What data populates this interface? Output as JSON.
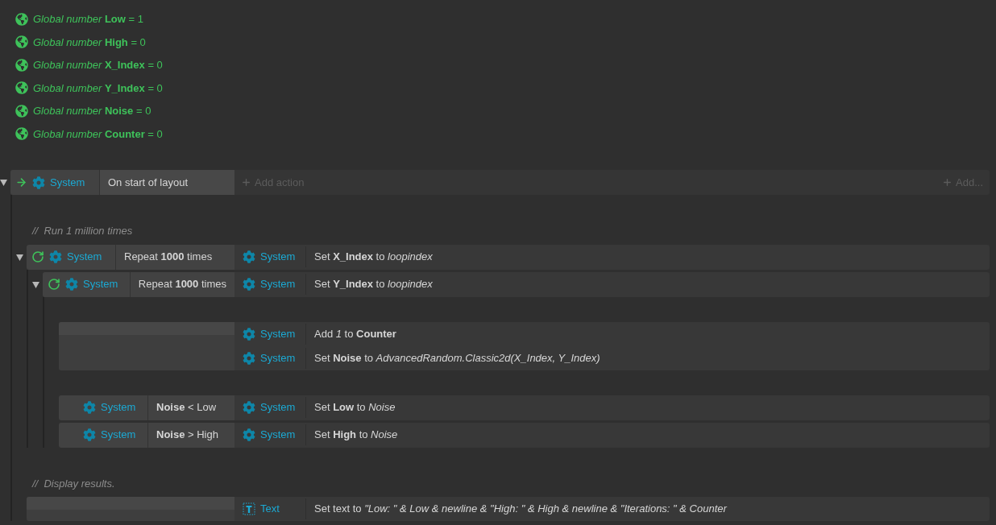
{
  "globals": [
    {
      "text": "*Global number* **Low** = 1"
    },
    {
      "text": "*Global number* **High** = 0"
    },
    {
      "text": "*Global number* **X_Index** = 0"
    },
    {
      "text": "*Global number* **Y_Index** = 0"
    },
    {
      "text": "*Global number* **Noise** = 0"
    },
    {
      "text": "*Global number* **Counter** = 0"
    }
  ],
  "events": [
    {
      "kind": "event",
      "expanded": true,
      "conditions": [
        {
          "kind": "trigger",
          "object": "System",
          "text": "On start of layout"
        }
      ],
      "add_action": "Add action",
      "add_more": "Add...",
      "children": [
        {
          "kind": "comment",
          "text": "//  Run 1 million times"
        },
        {
          "kind": "event",
          "expanded": true,
          "conditions": [
            {
              "kind": "loop",
              "object": "System",
              "text": "Repeat **1000** times"
            }
          ],
          "actions": [
            {
              "kind": "system",
              "object": "System",
              "text": "Set **X_Index** to *loopindex*"
            }
          ],
          "children": [
            {
              "kind": "event",
              "expanded": true,
              "conditions": [
                {
                  "kind": "loop",
                  "object": "System",
                  "text": "Repeat **1000** times"
                }
              ],
              "actions": [
                {
                  "kind": "system",
                  "object": "System",
                  "text": "Set **Y_Index** to *loopindex*"
                }
              ],
              "children": [
                {
                  "kind": "event",
                  "actions": [
                    {
                      "kind": "system",
                      "object": "System",
                      "text": "Add *1* to **Counter**"
                    },
                    {
                      "kind": "system",
                      "object": "System",
                      "text": "Set **Noise** to *AdvancedRandom.Classic2d(X_Index, Y_Index)*"
                    }
                  ]
                },
                {
                  "kind": "event",
                  "conditions": [
                    {
                      "kind": "plain",
                      "object": "System",
                      "text": "**Noise** < Low"
                    }
                  ],
                  "actions": [
                    {
                      "kind": "system",
                      "object": "System",
                      "text": "Set **Low** to *Noise*"
                    }
                  ]
                },
                {
                  "kind": "event",
                  "conditions": [
                    {
                      "kind": "plain",
                      "object": "System",
                      "text": "**Noise** > High"
                    }
                  ],
                  "actions": [
                    {
                      "kind": "system",
                      "object": "System",
                      "text": "Set **High** to *Noise*"
                    }
                  ]
                }
              ]
            }
          ]
        },
        {
          "kind": "comment",
          "text": "//  Display results."
        },
        {
          "kind": "event",
          "actions": [
            {
              "kind": "text",
              "object": "Text",
              "text": "Set text to *\"Low: \" & Low & newline & \"High: \" & High & newline & \"Iterations: \" & Counter*"
            }
          ]
        }
      ]
    }
  ]
}
